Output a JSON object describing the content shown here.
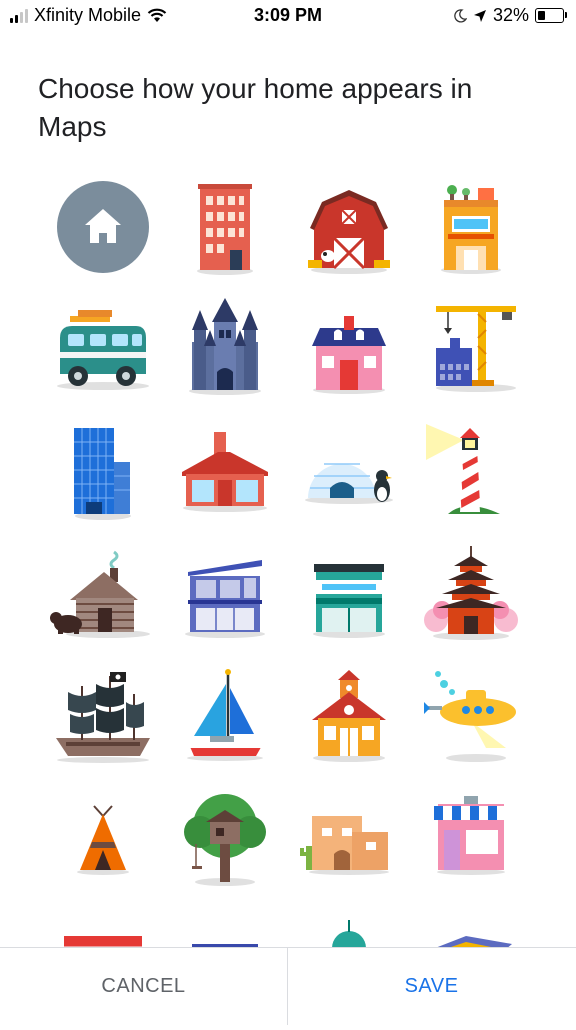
{
  "status_bar": {
    "carrier": "Xfinity Mobile",
    "time": "3:09 PM",
    "battery": "32%",
    "battery_level": 0.32
  },
  "title": "Choose how your home appears in Maps",
  "icons": [
    {
      "name": "home-default-icon",
      "selected": true
    },
    {
      "name": "brick-apartment-icon"
    },
    {
      "name": "red-barn-icon"
    },
    {
      "name": "rooftop-garden-shop-icon"
    },
    {
      "name": "camper-van-icon"
    },
    {
      "name": "castle-icon"
    },
    {
      "name": "pink-house-icon"
    },
    {
      "name": "crane-construction-icon"
    },
    {
      "name": "glass-skyscraper-icon"
    },
    {
      "name": "red-modern-house-icon"
    },
    {
      "name": "igloo-penguin-icon"
    },
    {
      "name": "lighthouse-icon"
    },
    {
      "name": "log-cabin-bear-icon"
    },
    {
      "name": "modern-villa-icon"
    },
    {
      "name": "teal-shop-building-icon"
    },
    {
      "name": "pagoda-icon"
    },
    {
      "name": "pirate-ship-icon"
    },
    {
      "name": "sailboat-icon"
    },
    {
      "name": "schoolhouse-icon"
    },
    {
      "name": "yellow-submarine-icon"
    },
    {
      "name": "teepee-icon"
    },
    {
      "name": "treehouse-icon"
    },
    {
      "name": "adobe-house-icon"
    },
    {
      "name": "storefront-icon"
    },
    {
      "name": "red-building-partial-icon"
    },
    {
      "name": "blue-building-partial-icon"
    },
    {
      "name": "green-dome-partial-icon"
    },
    {
      "name": "dragon-partial-icon"
    }
  ],
  "footer": {
    "cancel_label": "CANCEL",
    "save_label": "SAVE"
  },
  "colors": {
    "accent": "#1a73e8",
    "selected_circle": "#7b8d9c"
  }
}
